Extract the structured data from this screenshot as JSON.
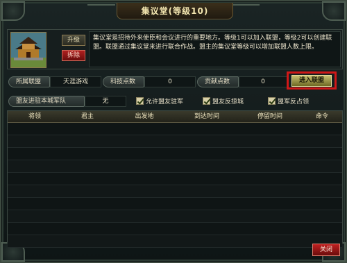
{
  "window": {
    "title": "集议堂(等级10)"
  },
  "building": {
    "upgrade_label": "升级",
    "demolish_label": "拆除",
    "description": "集议堂是招待外来使臣和会议进行的重要地方。等级1可以加入联盟，等级2可以创建联盟。联盟通过集议堂来进行联合作战。盟主的集议堂等级可以增加联盟人数上限。"
  },
  "stats": {
    "alliance_label": "所属联盟",
    "alliance_value": "天涯游戏",
    "tech_label": "科技点数",
    "tech_value": "0",
    "contribution_label": "贡献点数",
    "contribution_value": "0",
    "join_label": "进入联盟"
  },
  "garrison": {
    "label": "盟友进驻本城军队",
    "value": "无"
  },
  "options": {
    "allow_garrison": "允许盟友驻军",
    "counter_attack": "盟友反掠城",
    "reoccupy": "盟军反占领"
  },
  "table": {
    "columns": [
      "将领",
      "君主",
      "出发地",
      "到达时间",
      "停留时间",
      "命令"
    ]
  },
  "footer": {
    "close_label": "关闭"
  }
}
